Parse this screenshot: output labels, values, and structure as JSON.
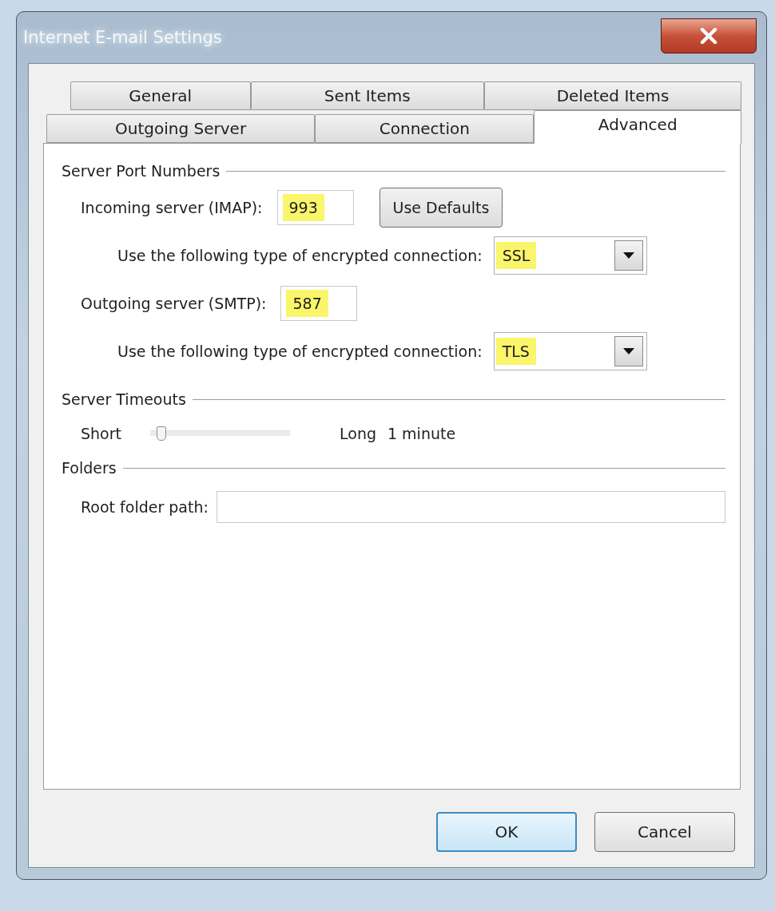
{
  "window": {
    "title": "Internet E-mail Settings"
  },
  "tab_rows": [
    [
      {
        "label": "General",
        "selected": false
      },
      {
        "label": "Sent Items",
        "selected": false
      },
      {
        "label": "Deleted Items",
        "selected": false
      }
    ],
    [
      {
        "label": "Outgoing Server",
        "selected": false
      },
      {
        "label": "Connection",
        "selected": false
      },
      {
        "label": "Advanced",
        "selected": true
      }
    ]
  ],
  "server_ports": {
    "title": "Server Port Numbers",
    "incoming": {
      "label": "Incoming server (IMAP):",
      "value": "993",
      "highlighted": true
    },
    "use_defaults_button": "Use Defaults",
    "incoming_encryption": {
      "label": "Use the following type of encrypted connection:",
      "value": "SSL",
      "highlighted": true
    },
    "outgoing": {
      "label": "Outgoing server (SMTP):",
      "value": "587",
      "highlighted": true
    },
    "outgoing_encryption": {
      "label": "Use the following type of encrypted connection:",
      "value": "TLS",
      "highlighted": true
    }
  },
  "server_timeouts": {
    "title": "Server Timeouts",
    "min_label": "Short",
    "level": 0.05,
    "max_label": "Long",
    "reading": "1 minute"
  },
  "folders": {
    "title": "Folders",
    "root_folder": {
      "label": "Root folder path:"
    }
  },
  "buttons": [
    {
      "label": "OK",
      "default": true
    },
    {
      "label": "Cancel",
      "default": false
    }
  ]
}
